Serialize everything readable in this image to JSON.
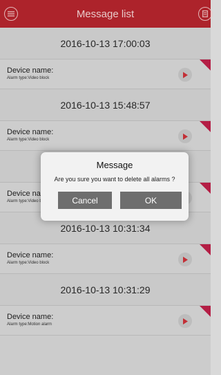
{
  "header": {
    "title": "Message list",
    "left_icon": "menu-circle-icon",
    "right_icon": "delete-circle-icon",
    "background": "#b8262e"
  },
  "alarms": [
    {
      "date": "2016-10-13 17:00:03",
      "device_label": "Device name:",
      "alarm_type": "Alarm type:Video block"
    },
    {
      "date": "2016-10-13 15:48:57",
      "device_label": "Device name:",
      "alarm_type": "Alarm type:Video block"
    },
    {
      "date": "",
      "device_label": "Device name:",
      "alarm_type": "Alarm type:Video block"
    },
    {
      "date": "2016-10-13 10:31:34",
      "device_label": "Device name:",
      "alarm_type": "Alarm type:Video block"
    },
    {
      "date": "2016-10-13 10:31:29",
      "device_label": "Device name:",
      "alarm_type": "Alarm type:Motion alarm"
    }
  ],
  "dialog": {
    "title": "Message",
    "message": "Are you sure you want to delete all alarms ?",
    "cancel_label": "Cancel",
    "ok_label": "OK"
  },
  "colors": {
    "accent": "#b8262e",
    "play": "#d0323a",
    "corner": "#c0204a"
  }
}
